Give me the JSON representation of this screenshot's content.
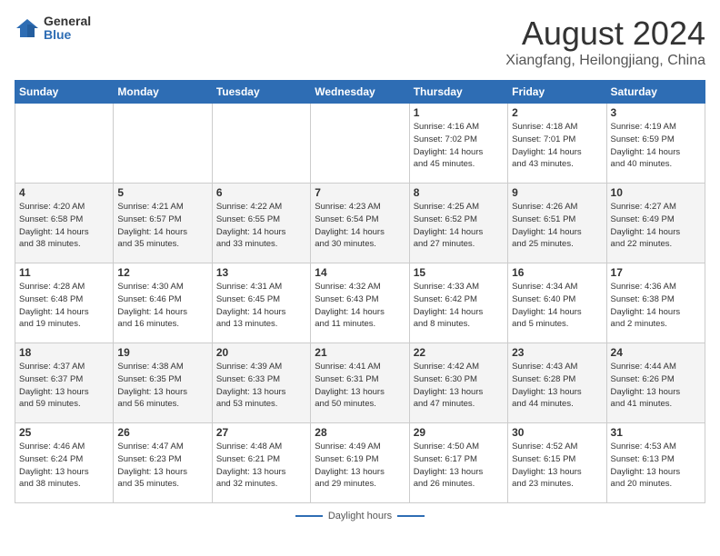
{
  "header": {
    "logo_general": "General",
    "logo_blue": "Blue",
    "month_year": "August 2024",
    "location": "Xiangfang, Heilongjiang, China"
  },
  "days_of_week": [
    "Sunday",
    "Monday",
    "Tuesday",
    "Wednesday",
    "Thursday",
    "Friday",
    "Saturday"
  ],
  "footer": {
    "label": "Daylight hours"
  },
  "weeks": [
    [
      {
        "day": "",
        "info": ""
      },
      {
        "day": "",
        "info": ""
      },
      {
        "day": "",
        "info": ""
      },
      {
        "day": "",
        "info": ""
      },
      {
        "day": "1",
        "info": "Sunrise: 4:16 AM\nSunset: 7:02 PM\nDaylight: 14 hours\nand 45 minutes."
      },
      {
        "day": "2",
        "info": "Sunrise: 4:18 AM\nSunset: 7:01 PM\nDaylight: 14 hours\nand 43 minutes."
      },
      {
        "day": "3",
        "info": "Sunrise: 4:19 AM\nSunset: 6:59 PM\nDaylight: 14 hours\nand 40 minutes."
      }
    ],
    [
      {
        "day": "4",
        "info": "Sunrise: 4:20 AM\nSunset: 6:58 PM\nDaylight: 14 hours\nand 38 minutes."
      },
      {
        "day": "5",
        "info": "Sunrise: 4:21 AM\nSunset: 6:57 PM\nDaylight: 14 hours\nand 35 minutes."
      },
      {
        "day": "6",
        "info": "Sunrise: 4:22 AM\nSunset: 6:55 PM\nDaylight: 14 hours\nand 33 minutes."
      },
      {
        "day": "7",
        "info": "Sunrise: 4:23 AM\nSunset: 6:54 PM\nDaylight: 14 hours\nand 30 minutes."
      },
      {
        "day": "8",
        "info": "Sunrise: 4:25 AM\nSunset: 6:52 PM\nDaylight: 14 hours\nand 27 minutes."
      },
      {
        "day": "9",
        "info": "Sunrise: 4:26 AM\nSunset: 6:51 PM\nDaylight: 14 hours\nand 25 minutes."
      },
      {
        "day": "10",
        "info": "Sunrise: 4:27 AM\nSunset: 6:49 PM\nDaylight: 14 hours\nand 22 minutes."
      }
    ],
    [
      {
        "day": "11",
        "info": "Sunrise: 4:28 AM\nSunset: 6:48 PM\nDaylight: 14 hours\nand 19 minutes."
      },
      {
        "day": "12",
        "info": "Sunrise: 4:30 AM\nSunset: 6:46 PM\nDaylight: 14 hours\nand 16 minutes."
      },
      {
        "day": "13",
        "info": "Sunrise: 4:31 AM\nSunset: 6:45 PM\nDaylight: 14 hours\nand 13 minutes."
      },
      {
        "day": "14",
        "info": "Sunrise: 4:32 AM\nSunset: 6:43 PM\nDaylight: 14 hours\nand 11 minutes."
      },
      {
        "day": "15",
        "info": "Sunrise: 4:33 AM\nSunset: 6:42 PM\nDaylight: 14 hours\nand 8 minutes."
      },
      {
        "day": "16",
        "info": "Sunrise: 4:34 AM\nSunset: 6:40 PM\nDaylight: 14 hours\nand 5 minutes."
      },
      {
        "day": "17",
        "info": "Sunrise: 4:36 AM\nSunset: 6:38 PM\nDaylight: 14 hours\nand 2 minutes."
      }
    ],
    [
      {
        "day": "18",
        "info": "Sunrise: 4:37 AM\nSunset: 6:37 PM\nDaylight: 13 hours\nand 59 minutes."
      },
      {
        "day": "19",
        "info": "Sunrise: 4:38 AM\nSunset: 6:35 PM\nDaylight: 13 hours\nand 56 minutes."
      },
      {
        "day": "20",
        "info": "Sunrise: 4:39 AM\nSunset: 6:33 PM\nDaylight: 13 hours\nand 53 minutes."
      },
      {
        "day": "21",
        "info": "Sunrise: 4:41 AM\nSunset: 6:31 PM\nDaylight: 13 hours\nand 50 minutes."
      },
      {
        "day": "22",
        "info": "Sunrise: 4:42 AM\nSunset: 6:30 PM\nDaylight: 13 hours\nand 47 minutes."
      },
      {
        "day": "23",
        "info": "Sunrise: 4:43 AM\nSunset: 6:28 PM\nDaylight: 13 hours\nand 44 minutes."
      },
      {
        "day": "24",
        "info": "Sunrise: 4:44 AM\nSunset: 6:26 PM\nDaylight: 13 hours\nand 41 minutes."
      }
    ],
    [
      {
        "day": "25",
        "info": "Sunrise: 4:46 AM\nSunset: 6:24 PM\nDaylight: 13 hours\nand 38 minutes."
      },
      {
        "day": "26",
        "info": "Sunrise: 4:47 AM\nSunset: 6:23 PM\nDaylight: 13 hours\nand 35 minutes."
      },
      {
        "day": "27",
        "info": "Sunrise: 4:48 AM\nSunset: 6:21 PM\nDaylight: 13 hours\nand 32 minutes."
      },
      {
        "day": "28",
        "info": "Sunrise: 4:49 AM\nSunset: 6:19 PM\nDaylight: 13 hours\nand 29 minutes."
      },
      {
        "day": "29",
        "info": "Sunrise: 4:50 AM\nSunset: 6:17 PM\nDaylight: 13 hours\nand 26 minutes."
      },
      {
        "day": "30",
        "info": "Sunrise: 4:52 AM\nSunset: 6:15 PM\nDaylight: 13 hours\nand 23 minutes."
      },
      {
        "day": "31",
        "info": "Sunrise: 4:53 AM\nSunset: 6:13 PM\nDaylight: 13 hours\nand 20 minutes."
      }
    ]
  ]
}
